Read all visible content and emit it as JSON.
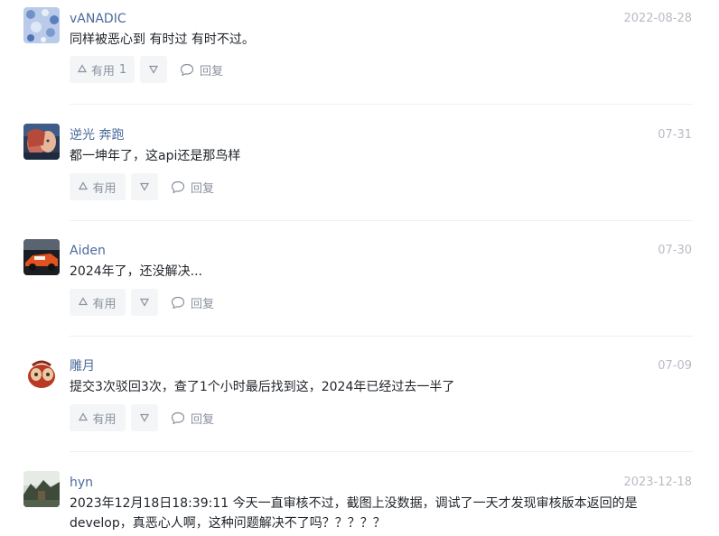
{
  "comments": [
    {
      "username": "vANADIC",
      "time": "2022-08-28",
      "content": "同样被恶心到 有时过 有时不过。",
      "like_label": "有用",
      "like_count": "1",
      "reply_label": "回复"
    },
    {
      "username": "逆光 奔跑",
      "time": "07-31",
      "content": "都一坤年了，这api还是那鸟样",
      "like_label": "有用",
      "reply_label": "回复"
    },
    {
      "username": "Aiden",
      "time": "07-30",
      "content": "2024年了，还没解决...",
      "like_label": "有用",
      "reply_label": "回复"
    },
    {
      "username": "雕月",
      "time": "07-09",
      "content": "提交3次驳回3次，查了1个小时最后找到这，2024年已经过去一半了",
      "like_label": "有用",
      "reply_label": "回复"
    },
    {
      "username": "hyn",
      "time": "2023-12-18",
      "content": "2023年12月18日18:39:11 今天一直审核不过，截图上没数据，调试了一天才发现审核版本返回的是develop，真恶心人啊，这种问题解决不了吗？？？？？"
    }
  ],
  "colors": {
    "username": "#4b6a9b",
    "time": "#b8bcc4",
    "button_bg": "#f4f5f7",
    "action_text": "#8a919f"
  },
  "icons": [
    "upvote-triangle-icon",
    "downvote-triangle-icon",
    "speech-bubble-icon"
  ]
}
